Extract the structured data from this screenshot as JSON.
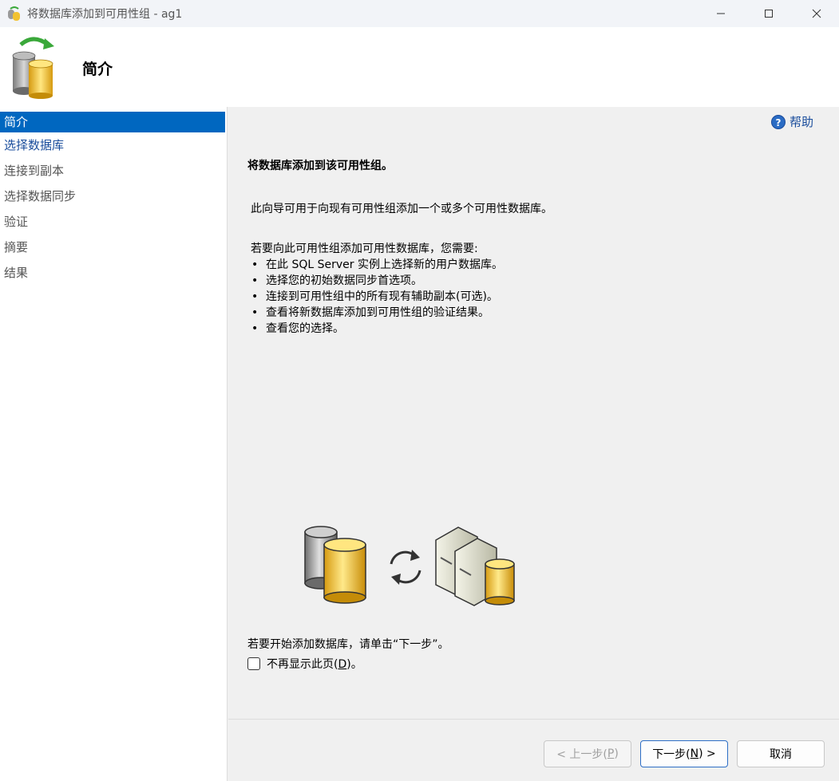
{
  "window": {
    "title": "将数据库添加到可用性组 - ag1"
  },
  "header": {
    "title": "简介"
  },
  "sidebar": {
    "items": [
      {
        "label": "简介"
      },
      {
        "label": "选择数据库"
      },
      {
        "label": "连接到副本"
      },
      {
        "label": "选择数据同步"
      },
      {
        "label": "验证"
      },
      {
        "label": "摘要"
      },
      {
        "label": "结果"
      }
    ]
  },
  "main": {
    "help_label": "帮助",
    "heading": "将数据库添加到该可用性组。",
    "para1": "此向导可用于向现有可用性组添加一个或多个可用性数据库。",
    "para2_intro": "若要向此可用性组添加可用性数据库，您需要:",
    "bullets": [
      "在此 SQL Server 实例上选择新的用户数据库。",
      "选择您的初始数据同步首选项。",
      "连接到可用性组中的所有现有辅助副本(可选)。",
      "查看将新数据库添加到可用性组的验证结果。",
      "查看您的选择。"
    ],
    "start_text": "若要开始添加数据库，请单击“下一步”。",
    "checkbox_label_pre": "不再显示此页(",
    "checkbox_label_key": "D",
    "checkbox_label_post": ")。"
  },
  "footer": {
    "prev_pre": "< 上一步(",
    "prev_key": "P",
    "prev_post": ")",
    "next_pre": "下一步(",
    "next_key": "N",
    "next_post": ") >",
    "cancel": "取消"
  },
  "colors": {
    "accent": "#0067c0",
    "link": "#1a4d9c"
  }
}
